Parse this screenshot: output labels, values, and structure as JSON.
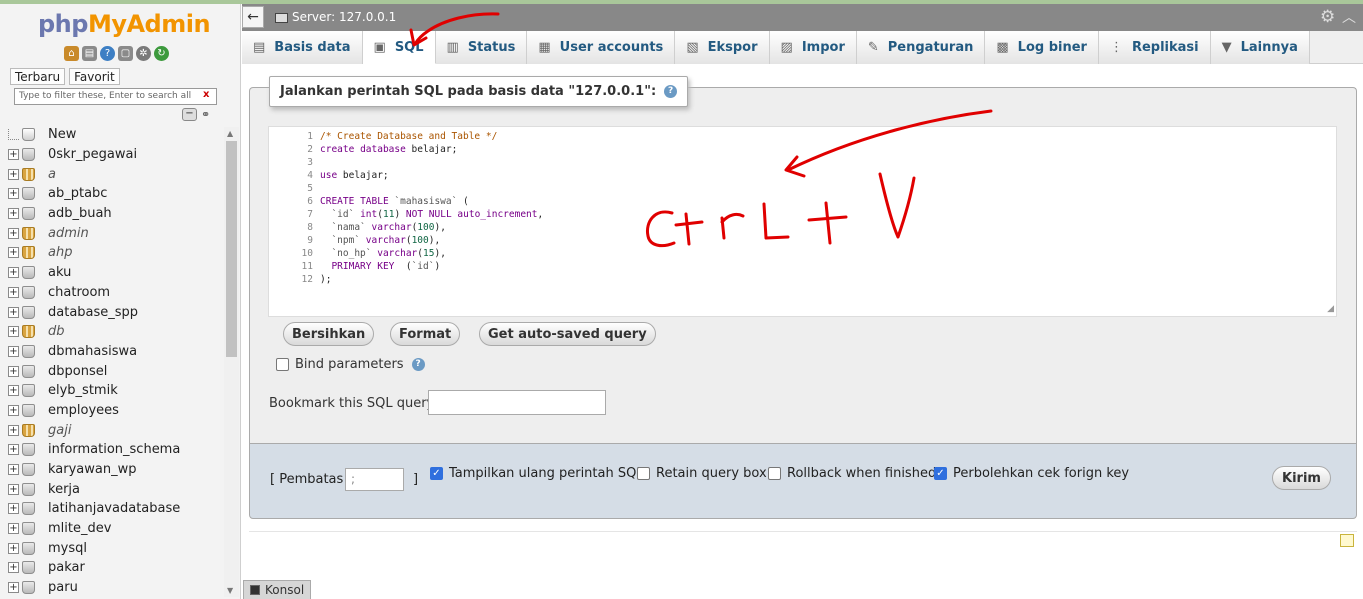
{
  "logo": {
    "php": "php",
    "mya": "MyAdmin"
  },
  "logo_icons": [
    "home-icon",
    "db-icon",
    "info-icon",
    "docs-icon",
    "settings-icon",
    "reload-icon"
  ],
  "nav_tabs": [
    "Terbaru",
    "Favorit"
  ],
  "filter_placeholder": "Type to filter these, Enter to search all",
  "filter_clear": "x",
  "databases": [
    {
      "name": "New",
      "type": "new"
    },
    {
      "name": "0skr_pegawai",
      "type": "db"
    },
    {
      "name": "a",
      "type": "grid"
    },
    {
      "name": "ab_ptabc",
      "type": "db"
    },
    {
      "name": "adb_buah",
      "type": "db"
    },
    {
      "name": "admin",
      "type": "grid"
    },
    {
      "name": "ahp",
      "type": "grid"
    },
    {
      "name": "aku",
      "type": "db"
    },
    {
      "name": "chatroom",
      "type": "db"
    },
    {
      "name": "database_spp",
      "type": "db"
    },
    {
      "name": "db",
      "type": "grid"
    },
    {
      "name": "dbmahasiswa",
      "type": "db"
    },
    {
      "name": "dbponsel",
      "type": "db"
    },
    {
      "name": "elyb_stmik",
      "type": "db"
    },
    {
      "name": "employees",
      "type": "db"
    },
    {
      "name": "gaji",
      "type": "grid"
    },
    {
      "name": "information_schema",
      "type": "db"
    },
    {
      "name": "karyawan_wp",
      "type": "db"
    },
    {
      "name": "kerja",
      "type": "db"
    },
    {
      "name": "latihanjavadatabase",
      "type": "db"
    },
    {
      "name": "mlite_dev",
      "type": "db"
    },
    {
      "name": "mysql",
      "type": "db"
    },
    {
      "name": "pakar",
      "type": "db"
    },
    {
      "name": "paru",
      "type": "db"
    }
  ],
  "server_title": "Server: 127.0.0.1",
  "menu_tabs": [
    {
      "label": "Basis data",
      "icon": "database-icon",
      "active": false
    },
    {
      "label": "SQL",
      "icon": "sql-icon",
      "active": true
    },
    {
      "label": "Status",
      "icon": "status-icon",
      "active": false
    },
    {
      "label": "User accounts",
      "icon": "users-icon",
      "active": false
    },
    {
      "label": "Ekspor",
      "icon": "export-icon",
      "active": false
    },
    {
      "label": "Impor",
      "icon": "import-icon",
      "active": false
    },
    {
      "label": "Pengaturan",
      "icon": "wrench-icon",
      "active": false
    },
    {
      "label": "Log biner",
      "icon": "log-icon",
      "active": false
    },
    {
      "label": "Replikasi",
      "icon": "replication-icon",
      "active": false
    },
    {
      "label": "Lainnya",
      "icon": "chevron-down-icon",
      "active": false
    }
  ],
  "sql_legend": "Jalankan perintah SQL pada basis data \"127.0.0.1\":",
  "code_lines": [
    "/* Create Database and Table */",
    "create database belajar;",
    "",
    "use belajar;",
    "",
    "CREATE TABLE `mahasiswa` (",
    "  `id` int(11) NOT NULL auto_increment,",
    "  `nama` varchar(100),",
    "  `npm` varchar(100),",
    "  `no_hp` varchar(15),",
    "  PRIMARY KEY  (`id`)",
    ");"
  ],
  "line_numbers": [
    "1",
    "2",
    "3",
    "4",
    "5",
    "6",
    "7",
    "8",
    "9",
    "10",
    "11",
    "12"
  ],
  "buttons": {
    "clear": "Bersihkan",
    "format": "Format",
    "autosaved": "Get auto-saved query"
  },
  "bind_parameters": "Bind parameters",
  "bookmark_label": "Bookmark this SQL query:",
  "delimiter": {
    "label": "[ Pembatas",
    "value": ";",
    "close": "]"
  },
  "options": {
    "show_query": {
      "label": "Tampilkan ulang perintah SQL",
      "checked": true
    },
    "retain": {
      "label": "Retain query box",
      "checked": false
    },
    "rollback": {
      "label": "Rollback when finished",
      "checked": false
    },
    "foreign": {
      "label": "Perbolehkan cek forign key",
      "checked": true
    }
  },
  "submit": "Kirim",
  "console": "Konsol",
  "annotation_color": "#e00000"
}
